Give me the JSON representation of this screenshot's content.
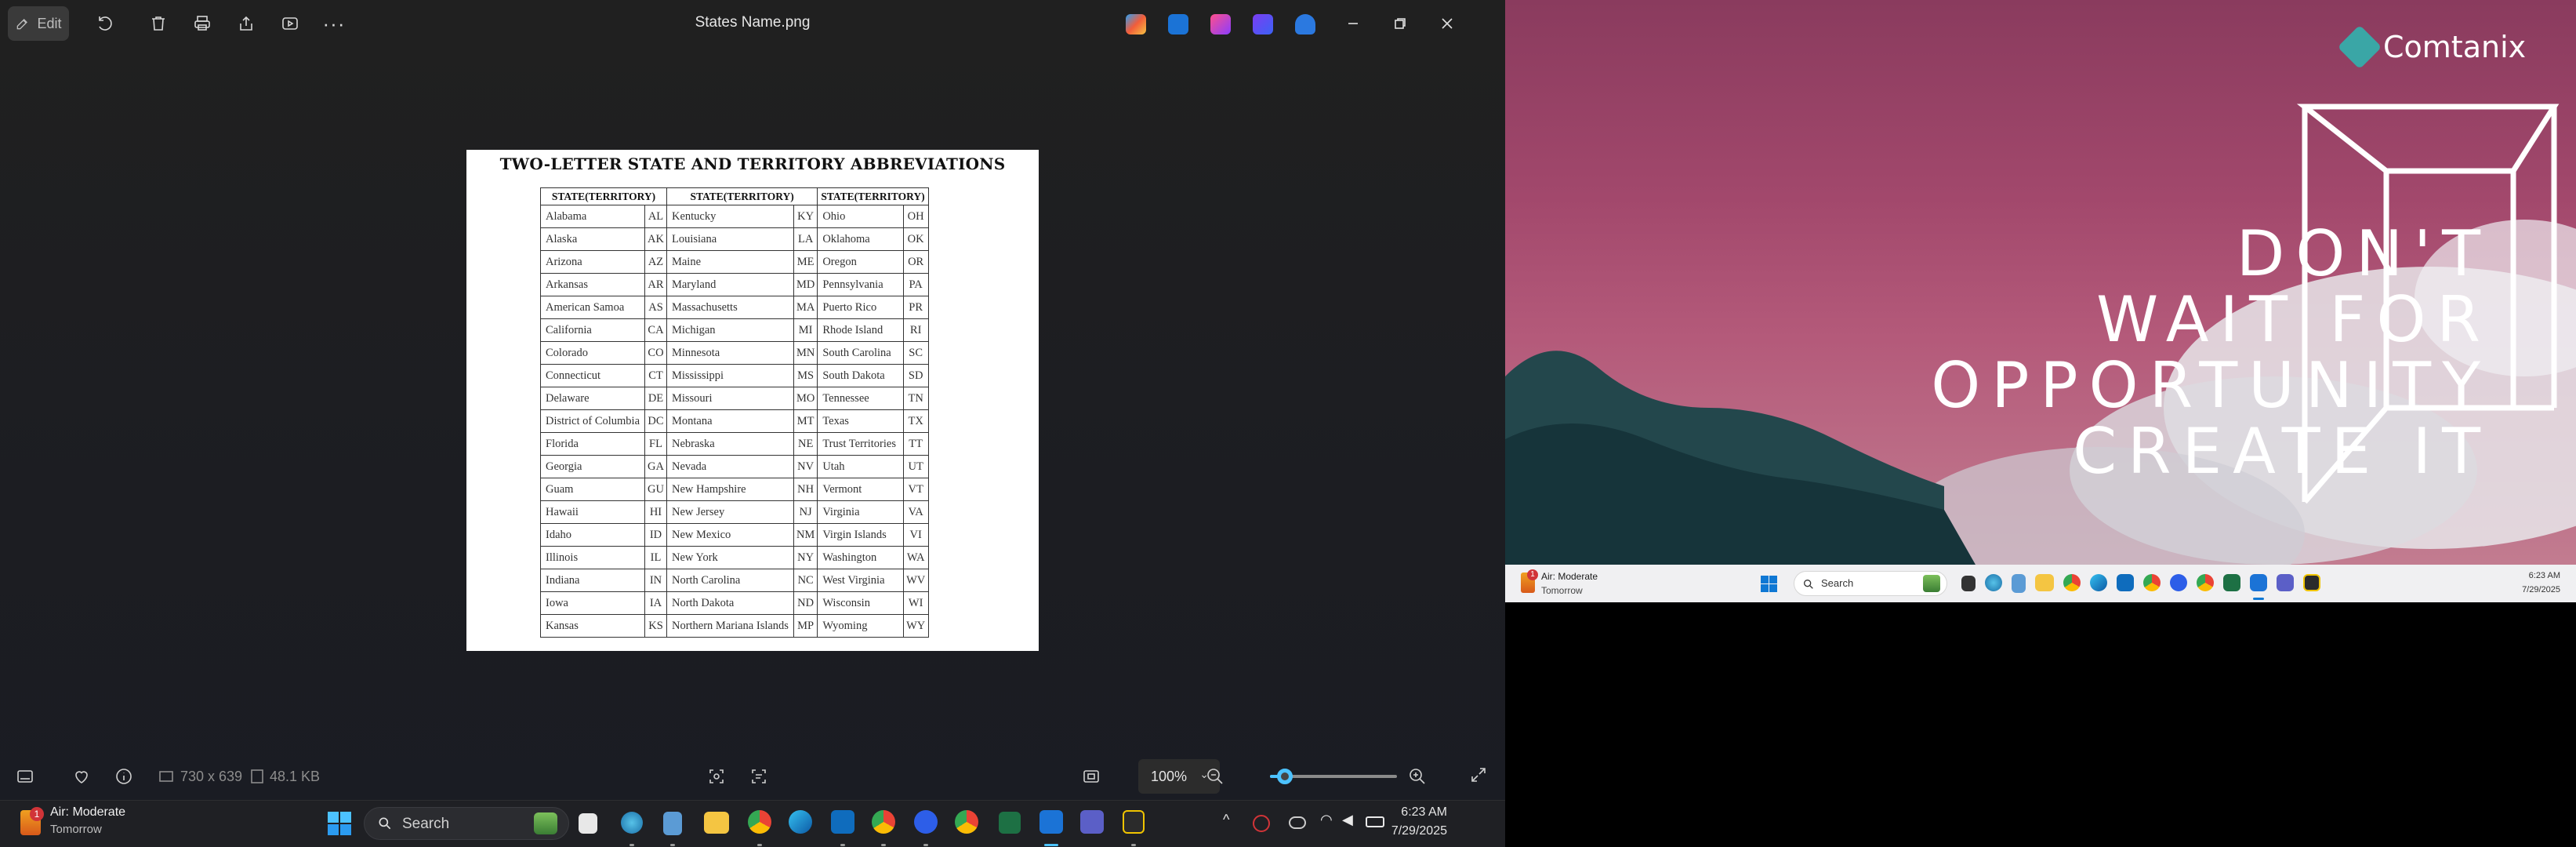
{
  "window": {
    "title": "States Name.png",
    "edit_label": "Edit"
  },
  "document": {
    "title": "TWO-LETTER STATE AND TERRITORY ABBREVIATIONS",
    "header": "STATE(TERRITORY)",
    "rows": [
      [
        "Alabama",
        "AL",
        "Kentucky",
        "KY",
        "Ohio",
        "OH"
      ],
      [
        "Alaska",
        "AK",
        "Louisiana",
        "LA",
        "Oklahoma",
        "OK"
      ],
      [
        "Arizona",
        "AZ",
        "Maine",
        "ME",
        "Oregon",
        "OR"
      ],
      [
        "Arkansas",
        "AR",
        "Maryland",
        "MD",
        "Pennsylvania",
        "PA"
      ],
      [
        "American Samoa",
        "AS",
        "Massachusetts",
        "MA",
        "Puerto Rico",
        "PR"
      ],
      [
        "California",
        "CA",
        "Michigan",
        "MI",
        "Rhode Island",
        "RI"
      ],
      [
        "Colorado",
        "CO",
        "Minnesota",
        "MN",
        "South Carolina",
        "SC"
      ],
      [
        "Connecticut",
        "CT",
        "Mississippi",
        "MS",
        "South Dakota",
        "SD"
      ],
      [
        "Delaware",
        "DE",
        "Missouri",
        "MO",
        "Tennessee",
        "TN"
      ],
      [
        "District of Columbia",
        "DC",
        "Montana",
        "MT",
        "Texas",
        "TX"
      ],
      [
        "Florida",
        "FL",
        "Nebraska",
        "NE",
        "Trust Territories",
        "TT"
      ],
      [
        "Georgia",
        "GA",
        "Nevada",
        "NV",
        "Utah",
        "UT"
      ],
      [
        "Guam",
        "GU",
        "New Hampshire",
        "NH",
        "Vermont",
        "VT"
      ],
      [
        "Hawaii",
        "HI",
        "New Jersey",
        "NJ",
        "Virginia",
        "VA"
      ],
      [
        "Idaho",
        "ID",
        "New Mexico",
        "NM",
        "Virgin Islands",
        "VI"
      ],
      [
        "Illinois",
        "IL",
        "New York",
        "NY",
        "Washington",
        "WA"
      ],
      [
        "Indiana",
        "IN",
        "North Carolina",
        "NC",
        "West Virginia",
        "WV"
      ],
      [
        "Iowa",
        "IA",
        "North Dakota",
        "ND",
        "Wisconsin",
        "WI"
      ],
      [
        "Kansas",
        "KS",
        "Northern Mariana Islands",
        "MP",
        "Wyoming",
        "WY"
      ]
    ]
  },
  "viewer": {
    "dimensions": "730 x 639",
    "file_size": "48.1 KB",
    "zoom": "100%",
    "zoom_fraction": 0.12
  },
  "taskbar_left": {
    "weather_title": "Air: Moderate",
    "weather_sub": "Tomorrow",
    "weather_badge": "1",
    "search_label": "Search",
    "time": "6:23 AM",
    "date": "7/29/2025"
  },
  "right_screen": {
    "brand": "Comtanix",
    "motto": [
      "DON'T",
      "WAIT FOR",
      "OPPORTUNITY",
      "CREATE IT"
    ],
    "taskbar": {
      "weather_title": "Air: Moderate",
      "weather_sub": "Tomorrow",
      "weather_badge": "1",
      "search_label": "Search",
      "time": "6:23 AM",
      "date": "7/29/2025"
    }
  },
  "colors": {
    "accent": "#4cc2ff",
    "wallpaper": "#a2486c"
  }
}
